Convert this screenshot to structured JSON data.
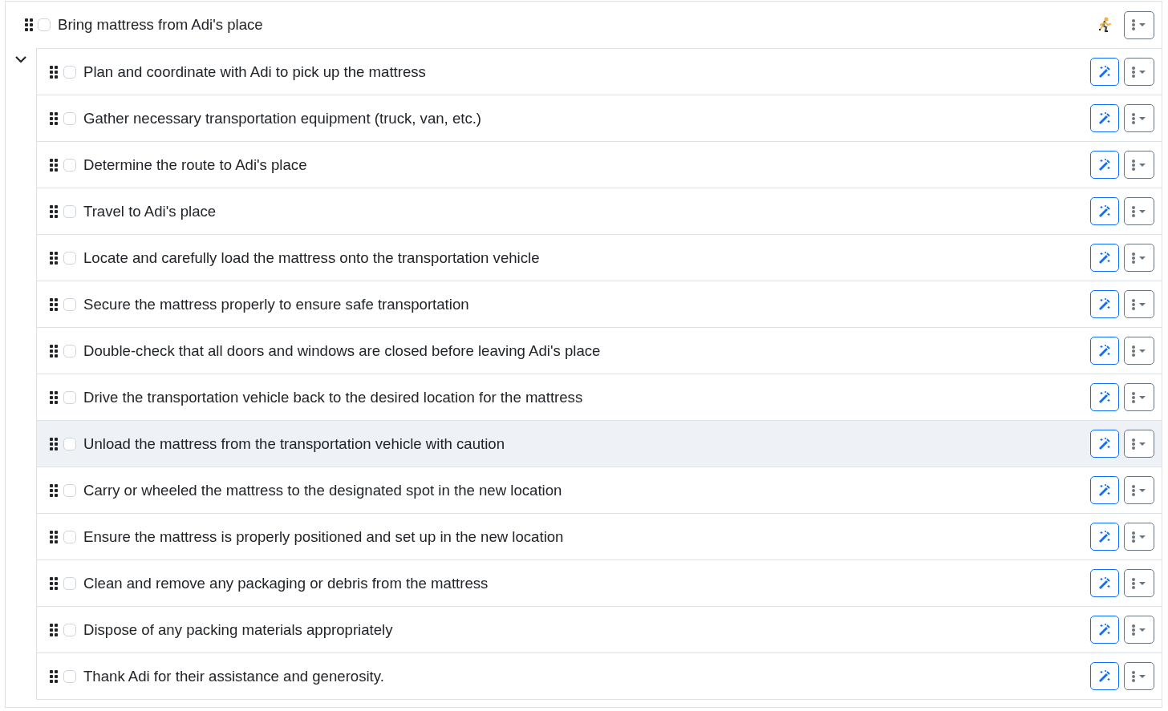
{
  "task": {
    "title": "Bring mattress from Adi's place",
    "checked": false,
    "expanded": true
  },
  "subtasks": [
    {
      "title": "Plan and coordinate with Adi to pick up the mattress",
      "checked": false,
      "highlighted": false
    },
    {
      "title": "Gather necessary transportation equipment (truck, van, etc.)",
      "checked": false,
      "highlighted": false
    },
    {
      "title": "Determine the route to Adi's place",
      "checked": false,
      "highlighted": false
    },
    {
      "title": "Travel to Adi's place",
      "checked": false,
      "highlighted": false
    },
    {
      "title": "Locate and carefully load the mattress onto the transportation vehicle",
      "checked": false,
      "highlighted": false
    },
    {
      "title": "Secure the mattress properly to ensure safe transportation",
      "checked": false,
      "highlighted": false
    },
    {
      "title": "Double-check that all doors and windows are closed before leaving Adi's place",
      "checked": false,
      "highlighted": false
    },
    {
      "title": "Drive the transportation vehicle back to the desired location for the mattress",
      "checked": false,
      "highlighted": false
    },
    {
      "title": "Unload the mattress from the transportation vehicle with caution",
      "checked": false,
      "highlighted": true
    },
    {
      "title": "Carry or wheeled the mattress to the designated spot in the new location",
      "checked": false,
      "highlighted": false
    },
    {
      "title": "Ensure the mattress is properly positioned and set up in the new location",
      "checked": false,
      "highlighted": false
    },
    {
      "title": "Clean and remove any packaging or debris from the mattress",
      "checked": false,
      "highlighted": false
    },
    {
      "title": "Dispose of any packing materials appropriately",
      "checked": false,
      "highlighted": false
    },
    {
      "title": "Thank Adi for their assistance and generosity.",
      "checked": false,
      "highlighted": false
    }
  ]
}
